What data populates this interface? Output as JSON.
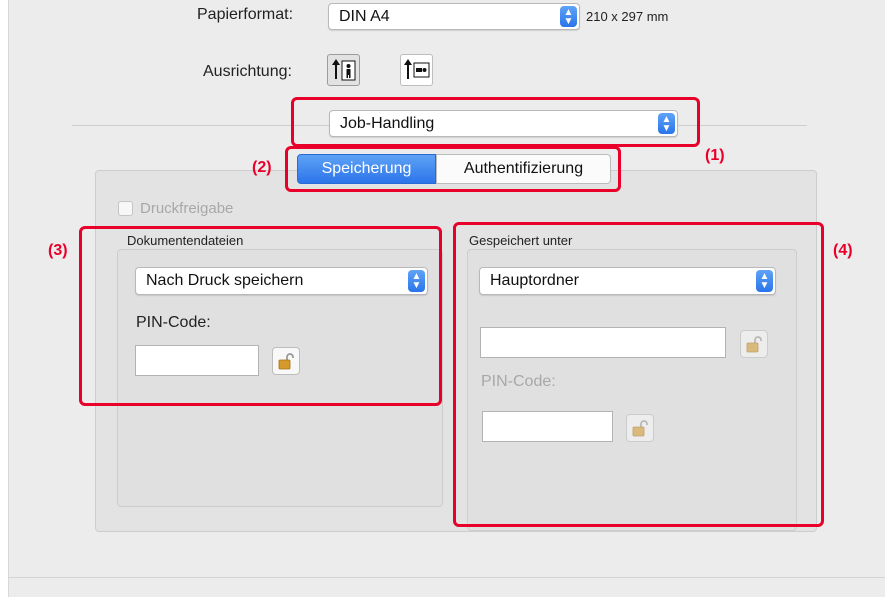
{
  "paper": {
    "label": "Papierformat:",
    "value": "DIN A4",
    "size": "210 x 297 mm"
  },
  "orientation": {
    "label": "Ausrichtung:",
    "options": [
      "portrait",
      "landscape"
    ],
    "selected": "portrait"
  },
  "panel_menu": {
    "value": "Job-Handling"
  },
  "tabs": [
    {
      "label": "Speicherung",
      "active": true
    },
    {
      "label": "Authentifizierung",
      "active": false
    }
  ],
  "druckfreigabe": {
    "label": "Druckfreigabe",
    "checked": false,
    "enabled": false
  },
  "dokumentendateien": {
    "title": "Dokumentendateien",
    "select_value": "Nach Druck speichern",
    "pin_label": "PIN-Code:",
    "pin_value": ""
  },
  "gespeichert_unter": {
    "title": "Gespeichert unter",
    "select_value": "Hauptordner",
    "folder_value": "",
    "pin_label": "PIN-Code:",
    "pin_value": ""
  },
  "callouts": [
    "(1)",
    "(2)",
    "(3)",
    "(4)"
  ],
  "colors": {
    "callout_red": "#e8002a",
    "tab_active": "#3478f6",
    "dialog_bg": "#ececec"
  }
}
